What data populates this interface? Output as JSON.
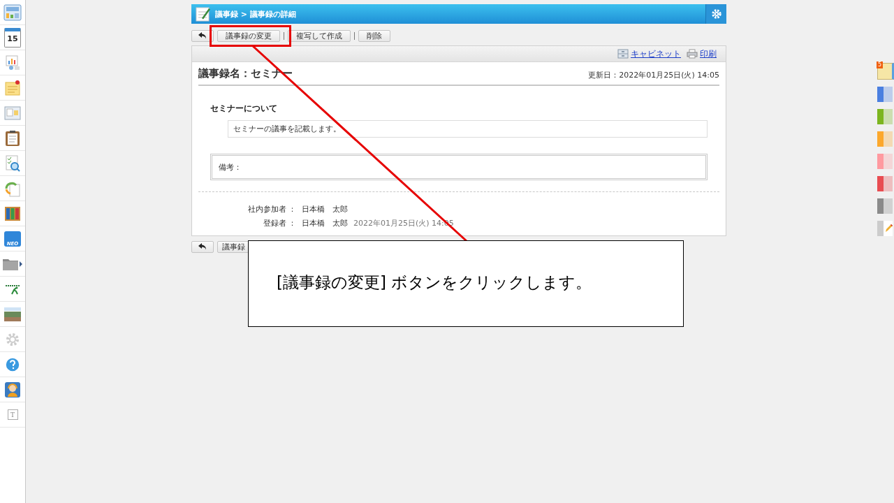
{
  "sidebar": {
    "calendar_day": "15",
    "neo_label": "NEO",
    "text_icon_letter": "T"
  },
  "header": {
    "title": "議事録 > 議事録の詳細"
  },
  "toolbar": {
    "buttons": [
      "議事録の変更",
      "複写して作成",
      "削除"
    ]
  },
  "links": [
    "キャビネット",
    "印刷"
  ],
  "record": {
    "title": "議事録名：セミナー",
    "updated": "更新日：2022年01月25日(火) 14:05",
    "section_title": "セミナーについて",
    "body": "セミナーの議事を記載します。",
    "note_label": "備考：",
    "meta": [
      {
        "label": "社内参加者 ：",
        "value": "日本橋　太郎"
      },
      {
        "label": "登録者 ：",
        "value": "日本橋　太郎",
        "date": "2022年01月25日(火) 14:05"
      }
    ]
  },
  "bottom_toolbar": {
    "buttons": [
      "議事録"
    ]
  },
  "right_panel": {
    "memo_badge": "5",
    "tabs": [
      {
        "color": "#4a7fe0"
      },
      {
        "color": "#7cb51f"
      },
      {
        "color": "#fca82c"
      },
      {
        "color": "#ff9aa0"
      },
      {
        "color": "#e84c51"
      },
      {
        "color": "#8a8a8a"
      }
    ]
  },
  "callout": {
    "text": "[議事録の変更] ボタンをクリックします。"
  }
}
